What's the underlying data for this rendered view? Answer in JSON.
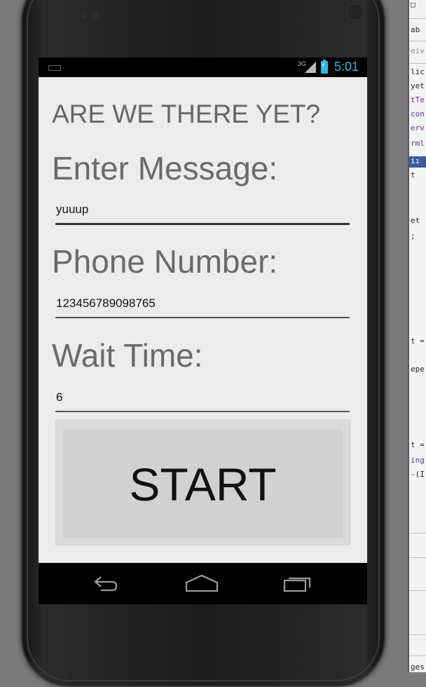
{
  "status_bar": {
    "network": "3G",
    "time": "5:01",
    "accent_color": "#33b5e5"
  },
  "app": {
    "title": "ARE WE THERE YET?",
    "message": {
      "label": "Enter Message:",
      "value": "yuuup"
    },
    "phone": {
      "label": "Phone Number:",
      "value": "123456789098765"
    },
    "wait": {
      "label": "Wait Time:",
      "value": "6"
    },
    "start_label": "START"
  },
  "nav": {
    "icons": [
      "back-icon",
      "home-icon",
      "recent-apps-icon"
    ]
  },
  "ide_fragments": {
    "top": "ab",
    "second": "eiv",
    "lines": [
      "lic",
      "yet",
      "tTe",
      "con",
      "erv",
      "rml",
      "iı",
      "t",
      "et",
      ";",
      "t =",
      "epe",
      "t =",
      "ing",
      "-(I",
      "ges"
    ]
  }
}
